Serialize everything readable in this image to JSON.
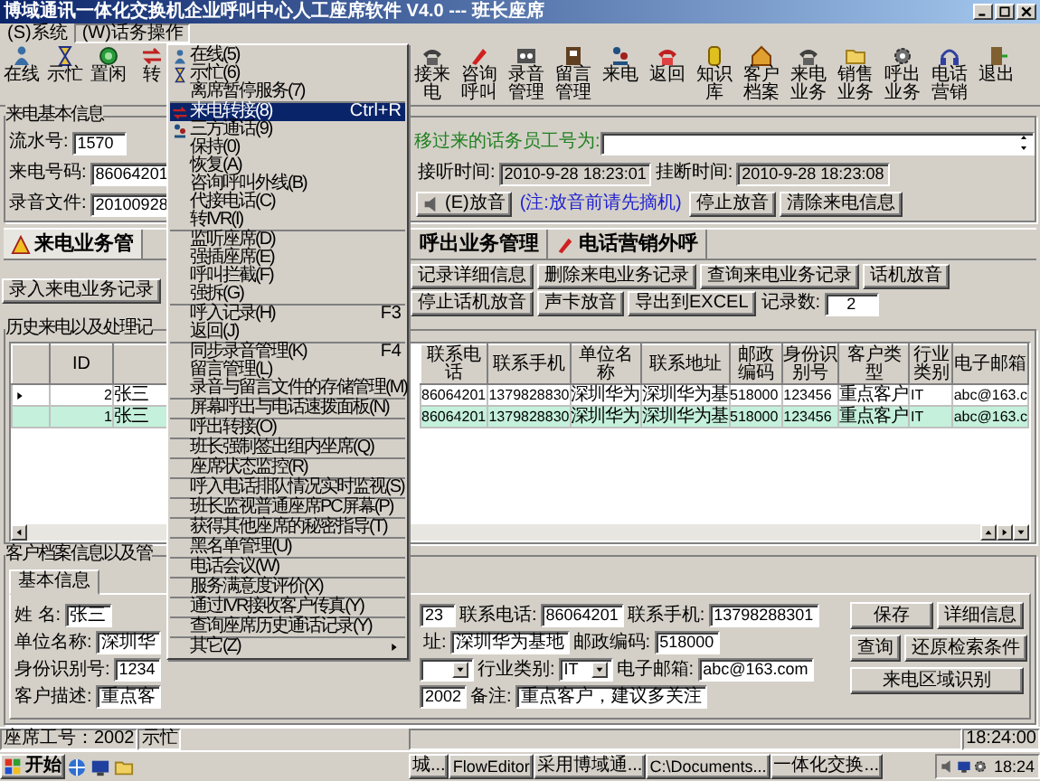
{
  "window": {
    "title": "博域通讯一体化交换机企业呼叫中心人工座席软件 V4.0 --- 班长座席"
  },
  "menu_bar": [
    {
      "label": "(S)系统",
      "selected": false
    },
    {
      "label": "(W)话务操作",
      "selected": true
    }
  ],
  "toolbar_left": [
    {
      "label": "在线"
    },
    {
      "label": "示忙"
    },
    {
      "label": "置闲"
    },
    {
      "label": "转"
    }
  ],
  "toolbar_right": [
    {
      "label": "接来电"
    },
    {
      "label": "咨询呼叫"
    },
    {
      "label": "录音管理"
    },
    {
      "label": "留言管理"
    },
    {
      "label": "来电"
    },
    {
      "label": "返回"
    },
    {
      "label": "知识库"
    },
    {
      "label": "客户档案"
    },
    {
      "label": "来电业务"
    },
    {
      "label": "销售业务"
    },
    {
      "label": "呼出业务"
    },
    {
      "label": "电话营销"
    },
    {
      "label": "退出"
    }
  ],
  "call_info": {
    "legend": "来电基本信息",
    "fields": [
      {
        "label": "流水号:",
        "value": "1570"
      },
      {
        "label": "来电号码:",
        "value": "86064201"
      },
      {
        "label": "录音文件:",
        "value": "20100928"
      }
    ],
    "transfer_note": "移过来的话务员工号为:",
    "answer_time": {
      "label": "接听时间:",
      "value": "2010-9-28 18:23:01"
    },
    "hangup_time": {
      "label": "挂断时间:",
      "value": "2010-9-28 18:23:08"
    },
    "play_button": "(E)放音",
    "play_hint": "(注:放音前请先摘机)",
    "stop_button": "停止放音",
    "clear_button": "清除来电信息"
  },
  "tabs": [
    {
      "label": "来电业务管",
      "selected": true
    },
    {
      "label": "呼出业务管理",
      "selected": false
    },
    {
      "label": "电话营销外呼",
      "selected": false
    }
  ],
  "record_buttons_left": [
    "录入来电业务记录"
  ],
  "record_buttons_right": [
    "记录详细信息",
    "删除来电业务记录",
    "查询来电业务记录",
    "话机放音",
    "停止话机放音",
    "声卡放音",
    "导出到EXCEL"
  ],
  "record_count": {
    "label": "记录数:",
    "value": "2"
  },
  "history": {
    "legend": "历史来电以及处理记",
    "left_columns": [
      "ID"
    ],
    "right_columns": [
      "联系电话",
      "联系手机",
      "单位名称",
      "联系地址",
      "邮政编码",
      "身份识别号",
      "客户类型",
      "行业类别",
      "电子邮箱"
    ],
    "rows": [
      {
        "id": "2",
        "name": "张三",
        "cells": [
          "86064201",
          "1379828830",
          "深圳华为",
          "深圳华为基",
          "518000",
          "123456",
          "重点客户",
          "IT",
          "abc@163.c"
        ],
        "selected": false,
        "current": true
      },
      {
        "id": "1",
        "name": "张三",
        "cells": [
          "86064201",
          "1379828830",
          "深圳华为",
          "深圳华为基",
          "518000",
          "123456",
          "重点客户",
          "IT",
          "abc@163.c"
        ],
        "selected": true,
        "current": false
      }
    ]
  },
  "customer": {
    "legend": "客户档案信息以及管",
    "tabs": [
      {
        "label": "基本信息",
        "selected": true
      }
    ],
    "rows": [
      {
        "left": {
          "label": "姓    名:",
          "value": "张三"
        },
        "right": [
          {
            "kind": "text",
            "value": "23"
          },
          {
            "kind": "text",
            "label": "联系电话:",
            "value": "86064201"
          },
          {
            "kind": "text",
            "label": "联系手机:",
            "value": "13798288301"
          }
        ]
      },
      {
        "left": {
          "label": "单位名称:",
          "value": "深圳华"
        },
        "right": [
          {
            "kind": "text",
            "label": "址:",
            "value": "深圳华为基地"
          },
          {
            "kind": "text",
            "label": "邮政编码:",
            "value": "518000"
          }
        ]
      },
      {
        "left": {
          "label": "身份识别号:",
          "value": "1234"
        },
        "right": [
          {
            "kind": "select"
          },
          {
            "kind": "select",
            "label": "行业类别:",
            "value": "IT"
          },
          {
            "kind": "text",
            "label": "电子邮箱:",
            "value": "abc@163.com"
          }
        ]
      },
      {
        "left": {
          "label": "客户描述:",
          "value": "重点客"
        },
        "right": [
          {
            "kind": "text",
            "value": "2002"
          },
          {
            "kind": "text",
            "label": "备注:",
            "value": "重点客户，建议多关注"
          }
        ]
      }
    ],
    "buttons": [
      [
        "保存",
        "详细信息"
      ],
      [
        "查询",
        "还原检索条件"
      ],
      [
        "来电区域识别"
      ]
    ]
  },
  "status_bar": {
    "left": [
      "座席工号：2002",
      "示忙"
    ],
    "time": "18:24:00"
  },
  "taskbar": {
    "start": "开始",
    "tasks": [
      "城...",
      "FlowEditor",
      "采用博域通...",
      "C:\\Documents...",
      "一体化交换..."
    ],
    "clock": "18:24"
  },
  "menu": [
    {
      "kind": "item",
      "label": "在线(5)",
      "icon": true,
      "selected": false
    },
    {
      "kind": "item",
      "label": "示忙(6)",
      "icon": true,
      "selected": false
    },
    {
      "kind": "item",
      "label": "离席暂停服务(7)",
      "icon": false,
      "selected": false
    },
    {
      "kind": "separator"
    },
    {
      "kind": "item",
      "label": "来电转接(8)",
      "shortcut": "Ctrl+R",
      "icon": true,
      "selected": true
    },
    {
      "kind": "item",
      "label": "三方通话(9)",
      "icon": true,
      "selected": false
    },
    {
      "kind": "item",
      "label": "保持(0)",
      "icon": false,
      "selected": false
    },
    {
      "kind": "item",
      "label": "恢复(A)",
      "icon": false,
      "selected": false
    },
    {
      "kind": "item",
      "label": "咨询呼叫外线(B)",
      "icon": false,
      "selected": false
    },
    {
      "kind": "item",
      "label": "代接电话(C)",
      "icon": false,
      "selected": false
    },
    {
      "kind": "item",
      "label": "转IVR(I)",
      "icon": false,
      "selected": false
    },
    {
      "kind": "separator"
    },
    {
      "kind": "item",
      "label": "监听座席(D)",
      "icon": false,
      "selected": false
    },
    {
      "kind": "item",
      "label": "强插座席(E)",
      "icon": false,
      "selected": false
    },
    {
      "kind": "item",
      "label": "呼叫拦截(F)",
      "icon": false,
      "selected": false
    },
    {
      "kind": "item",
      "label": "强拆(G)",
      "icon": false,
      "selected": false
    },
    {
      "kind": "separator"
    },
    {
      "kind": "item",
      "label": "呼入记录(H)",
      "shortcut": "F3",
      "icon": false,
      "selected": false
    },
    {
      "kind": "item",
      "label": "返回(J)",
      "icon": false,
      "selected": false
    },
    {
      "kind": "separator"
    },
    {
      "kind": "item",
      "label": "同步录音管理(K)",
      "shortcut": "F4",
      "icon": false,
      "selected": false
    },
    {
      "kind": "item",
      "label": "留言管理(L)",
      "icon": false,
      "selected": false
    },
    {
      "kind": "item",
      "label": "录音与留言文件的存储管理(M)",
      "icon": false,
      "selected": false
    },
    {
      "kind": "separator"
    },
    {
      "kind": "item",
      "label": "屏幕呼出与电话速拨面板(N)",
      "icon": false,
      "selected": false
    },
    {
      "kind": "separator"
    },
    {
      "kind": "item",
      "label": "呼出转接(O)",
      "icon": false,
      "selected": false
    },
    {
      "kind": "separator"
    },
    {
      "kind": "item",
      "label": "班长强制签出组内坐席(Q)",
      "icon": false,
      "selected": false
    },
    {
      "kind": "separator"
    },
    {
      "kind": "item",
      "label": "座席状态监控(R)",
      "icon": false,
      "selected": false
    },
    {
      "kind": "separator"
    },
    {
      "kind": "item",
      "label": "呼入电话排队情况实时监视(S)",
      "icon": false,
      "selected": false
    },
    {
      "kind": "separator"
    },
    {
      "kind": "item",
      "label": "班长监视普通座席PC屏幕(P)",
      "icon": false,
      "selected": false
    },
    {
      "kind": "separator"
    },
    {
      "kind": "item",
      "label": "获得其他座席的秘密指导(T)",
      "icon": false,
      "selected": false
    },
    {
      "kind": "separator"
    },
    {
      "kind": "item",
      "label": "黑名单管理(U)",
      "icon": false,
      "selected": false
    },
    {
      "kind": "separator"
    },
    {
      "kind": "item",
      "label": "电话会议(W)",
      "icon": false,
      "selected": false
    },
    {
      "kind": "separator"
    },
    {
      "kind": "item",
      "label": "服务满意度评价(X)",
      "icon": false,
      "selected": false
    },
    {
      "kind": "separator"
    },
    {
      "kind": "item",
      "label": "通过IVR接收客户传真(Y)",
      "icon": false,
      "selected": false
    },
    {
      "kind": "separator"
    },
    {
      "kind": "item",
      "label": "查询座席历史通话记录(Y)",
      "icon": false,
      "selected": false
    },
    {
      "kind": "separator"
    },
    {
      "kind": "item",
      "label": "其它(Z)",
      "icon": false,
      "submenu": true,
      "selected": false
    }
  ]
}
